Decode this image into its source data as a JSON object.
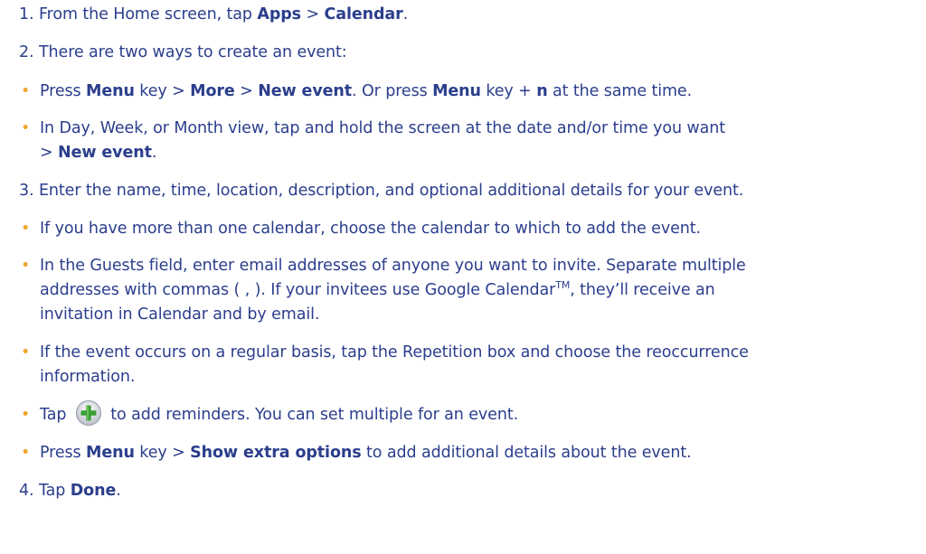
{
  "steps": {
    "s1": {
      "prefix": "1. From the Home screen, tap ",
      "b1": "Apps",
      "mid": " > ",
      "b2": "Calendar",
      "suffix": "."
    },
    "s2": {
      "text": "2. There are two ways to create an event:"
    },
    "b_menu": {
      "t1": "Press ",
      "b1": "Menu",
      "t2": " key > ",
      "b2": "More",
      "t3": " > ",
      "b3": "New event",
      "t4": ". Or press ",
      "b4": "Menu",
      "t5": " key + ",
      "b5": "n",
      "t6": " at the same time."
    },
    "b_day": {
      "line1": "In Day, Week, or Month view, tap and hold the screen at the date and/or time you want",
      "t1": "> ",
      "b1": "New event",
      "t2": "."
    },
    "s3": {
      "text": "3. Enter the name, time, location, description, and optional additional details for your event."
    },
    "b_cal": {
      "text": "If you have more than one calendar, choose the calendar to which to add the event."
    },
    "b_guest": {
      "line1": "In the Guests field, enter email addresses of anyone you want to invite. Separate multiple",
      "line2a": "addresses with commas ( , ). If your invitees use Google Calendar",
      "tm": "TM",
      "line2b": ", they’ll receive an",
      "line3": "invitation in Calendar and by email."
    },
    "b_rep": {
      "line1": "If the event occurs on a regular basis, tap the Repetition box and choose the reoccurrence",
      "line2": "information."
    },
    "b_tap": {
      "t1": "Tap",
      "t2": "to add reminders. You can set multiple for an event."
    },
    "b_extra": {
      "t1": "Press ",
      "b1": "Menu",
      "t2": " key > ",
      "b2": "Show extra options",
      "t3": " to add additional details about the event."
    },
    "s4": {
      "t1": "4. Tap ",
      "b1": "Done",
      "t2": "."
    },
    "bullet_char": "•",
    "icons": {
      "reminder": "add-plus-icon"
    }
  }
}
